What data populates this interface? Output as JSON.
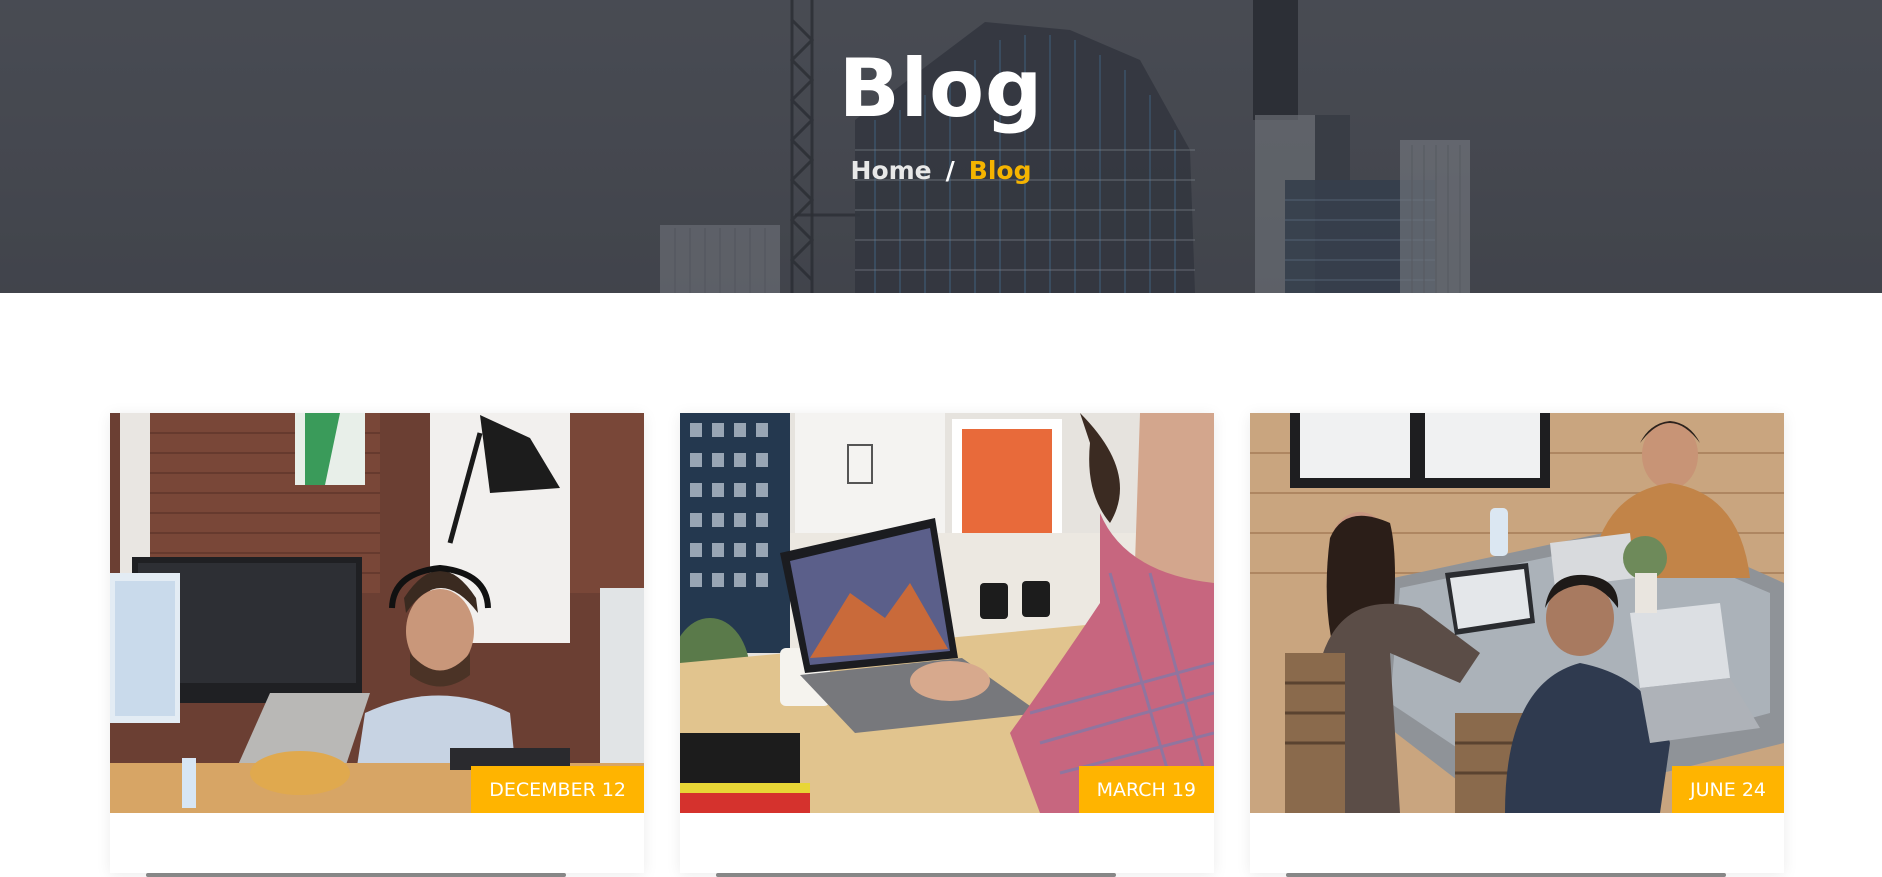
{
  "hero": {
    "title": "Blog",
    "breadcrumb": {
      "home_label": "Home",
      "separator": "/",
      "current_label": "Blog"
    },
    "overlay_color": "#46494f"
  },
  "posts": [
    {
      "date": "DECEMBER 12",
      "image": "man-with-headset-at-desk-photo"
    },
    {
      "date": "MARCH 19",
      "image": "laptop-on-wooden-desk-photo"
    },
    {
      "date": "JUNE 24",
      "image": "team-working-at-table-photo"
    }
  ],
  "colors": {
    "accent": "#ffb400",
    "breadcrumb_current": "#f5b400",
    "badge_text": "#ffffff"
  }
}
